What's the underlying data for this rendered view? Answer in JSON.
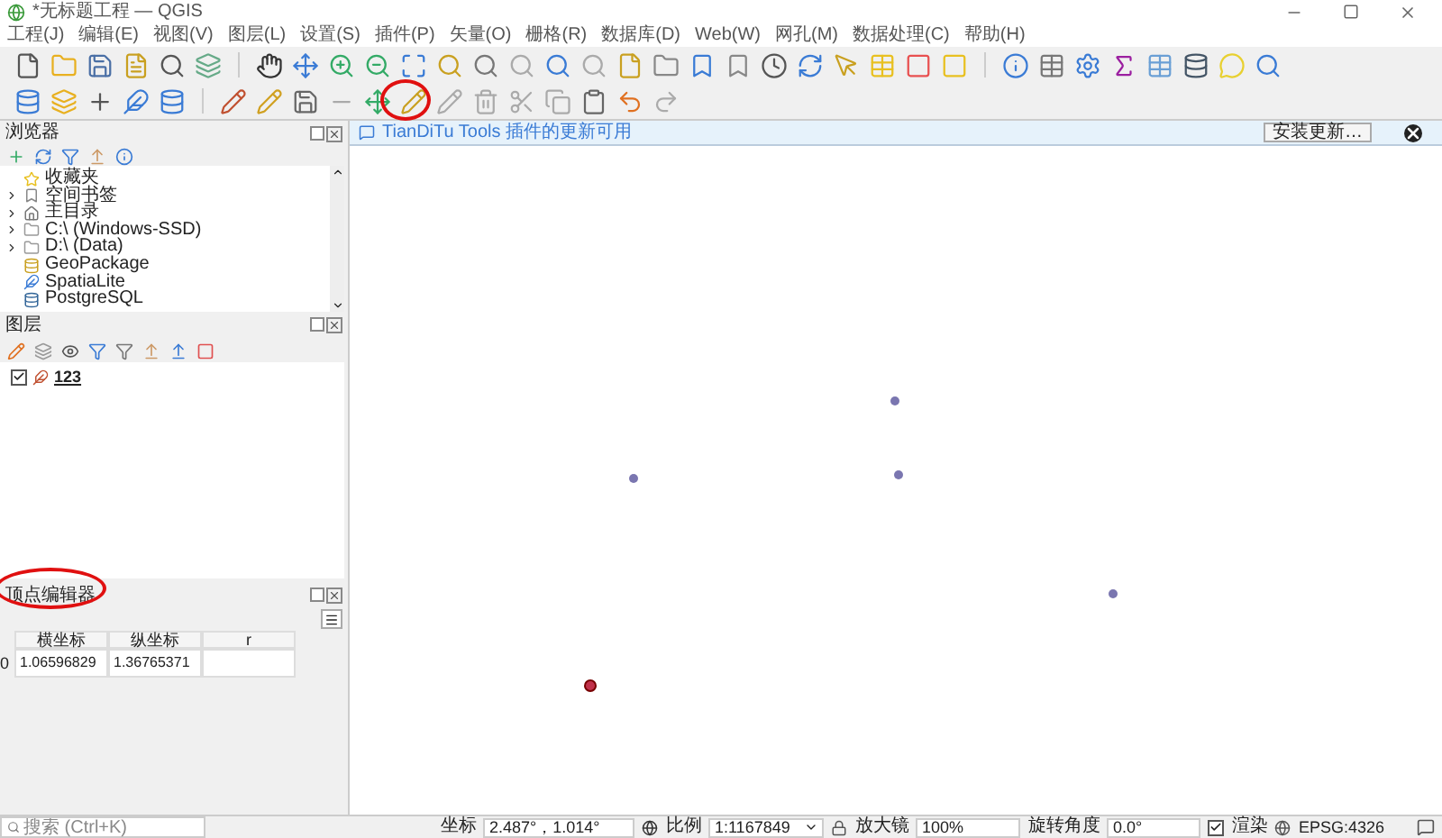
{
  "window": {
    "title": "*无标题工程 — QGIS"
  },
  "menu": [
    "工程(J)",
    "编辑(E)",
    "视图(V)",
    "图层(L)",
    "设置(S)",
    "插件(P)",
    "矢量(O)",
    "栅格(R)",
    "数据库(D)",
    "Web(W)",
    "网孔(M)",
    "数据处理(C)",
    "帮助(H)"
  ],
  "browser_panel": {
    "title": "浏览器",
    "items": [
      {
        "label": "收藏夹",
        "has_children": false
      },
      {
        "label": "空间书签",
        "has_children": true
      },
      {
        "label": "主目录",
        "has_children": true
      },
      {
        "label": "C:\\ (Windows-SSD)",
        "has_children": true
      },
      {
        "label": "D:\\ (Data)",
        "has_children": true
      },
      {
        "label": "GeoPackage",
        "has_children": false
      },
      {
        "label": "SpatiaLite",
        "has_children": false
      },
      {
        "label": "PostgreSQL",
        "has_children": false
      }
    ]
  },
  "layers_panel": {
    "title": "图层",
    "layers": [
      {
        "name": "123",
        "visible": true
      }
    ]
  },
  "vertex_editor": {
    "title": "顶点编辑器",
    "columns": [
      "横坐标",
      "纵坐标",
      "r"
    ],
    "rows": [
      {
        "index": "0",
        "cells": [
          "1.06596829",
          "1.36765371"
        ]
      }
    ]
  },
  "message_bar": {
    "text": "TianDiTu Tools 插件的更新可用",
    "button": "安装更新…"
  },
  "map": {
    "points": [
      {
        "selected": false
      },
      {
        "selected": false
      },
      {
        "selected": false
      },
      {
        "selected": false
      },
      {
        "selected": true
      }
    ]
  },
  "status_bar": {
    "search_placeholder": "搜索 (Ctrl+K)",
    "coordinate_label": "坐标",
    "coordinate": "2.487°，1.014°",
    "scale_label": "比例",
    "scale": "1:1167849",
    "magnifier_label": "放大镜",
    "magnifier": "100%",
    "rotation_label": "旋转角度",
    "rotation": "0.0°",
    "render": {
      "label": "渲染",
      "checked": true
    },
    "crs": "EPSG:4326"
  }
}
